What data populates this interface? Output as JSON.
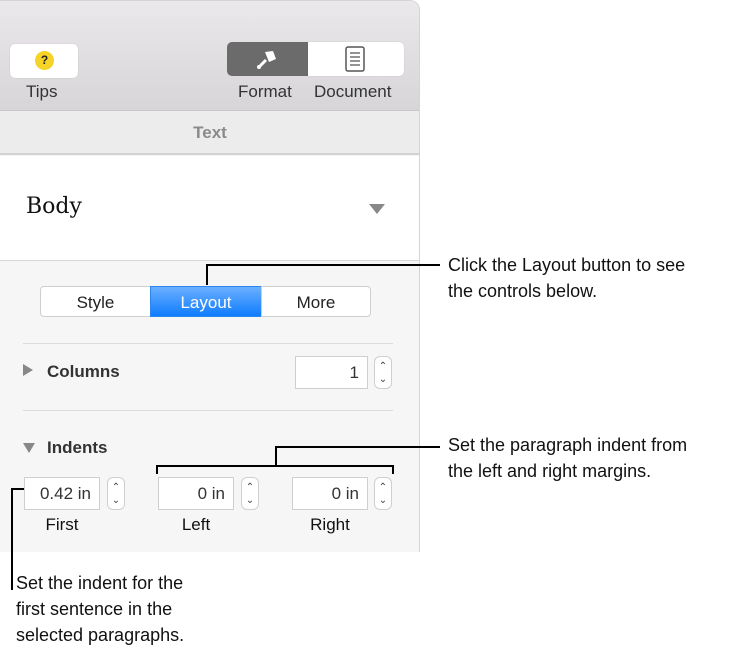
{
  "toolbar": {
    "tips": "Tips",
    "format": "Format",
    "document": "Document"
  },
  "tab": "Text",
  "paragraph_style": "Body",
  "segments": {
    "style": "Style",
    "layout": "Layout",
    "more": "More"
  },
  "columns": {
    "label": "Columns",
    "value": "1"
  },
  "indents": {
    "label": "Indents",
    "first": {
      "label": "First",
      "value": "0.42 in"
    },
    "left": {
      "label": "Left",
      "value": "0 in"
    },
    "right": {
      "label": "Right",
      "value": "0 in"
    }
  },
  "callouts": {
    "layout": [
      "Click the Layout button to see",
      "the controls below."
    ],
    "margins": [
      "Set the paragraph indent from",
      "the left and right margins."
    ],
    "first": [
      "Set the indent for the",
      "first sentence in the",
      "selected paragraphs."
    ]
  },
  "colors": {
    "accent": "#1a8cff",
    "format_active": "#6b6b6b",
    "tips_icon": "#f5d327"
  }
}
